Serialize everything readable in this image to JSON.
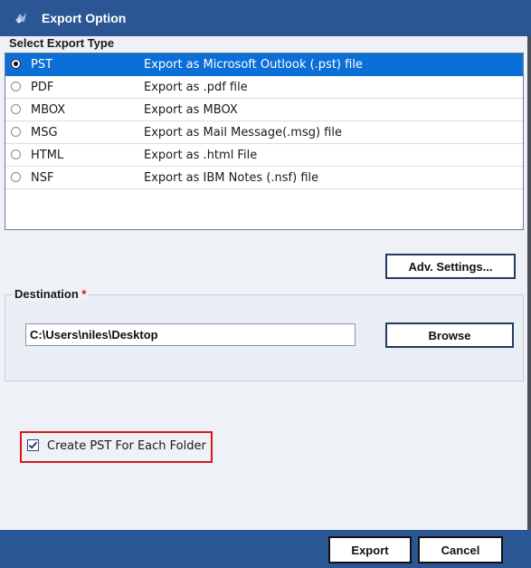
{
  "window": {
    "title": "Export Option",
    "icon": "app-icon"
  },
  "export_type": {
    "label": "Select Export Type",
    "options": [
      {
        "name": "PST",
        "description": "Export as Microsoft Outlook (.pst) file",
        "selected": true
      },
      {
        "name": "PDF",
        "description": "Export as .pdf file",
        "selected": false
      },
      {
        "name": "MBOX",
        "description": "Export as MBOX",
        "selected": false
      },
      {
        "name": "MSG",
        "description": "Export as Mail Message(.msg) file",
        "selected": false
      },
      {
        "name": "HTML",
        "description": "Export as .html File",
        "selected": false
      },
      {
        "name": "NSF",
        "description": "Export as IBM Notes (.nsf) file",
        "selected": false
      }
    ]
  },
  "advanced": {
    "button_label": "Adv. Settings..."
  },
  "destination": {
    "label": "Destination",
    "required_marker": "*",
    "path": "C:\\Users\\niles\\Desktop",
    "browse_label": "Browse"
  },
  "options": {
    "create_pst_per_folder_label": "Create PST For Each Folder",
    "create_pst_per_folder_checked": true
  },
  "footer": {
    "export_label": "Export",
    "cancel_label": "Cancel"
  },
  "colors": {
    "titlebar": "#2b5694",
    "selection": "#0b6fd8",
    "highlight_border": "#d21c1c",
    "required": "#d0101a"
  }
}
